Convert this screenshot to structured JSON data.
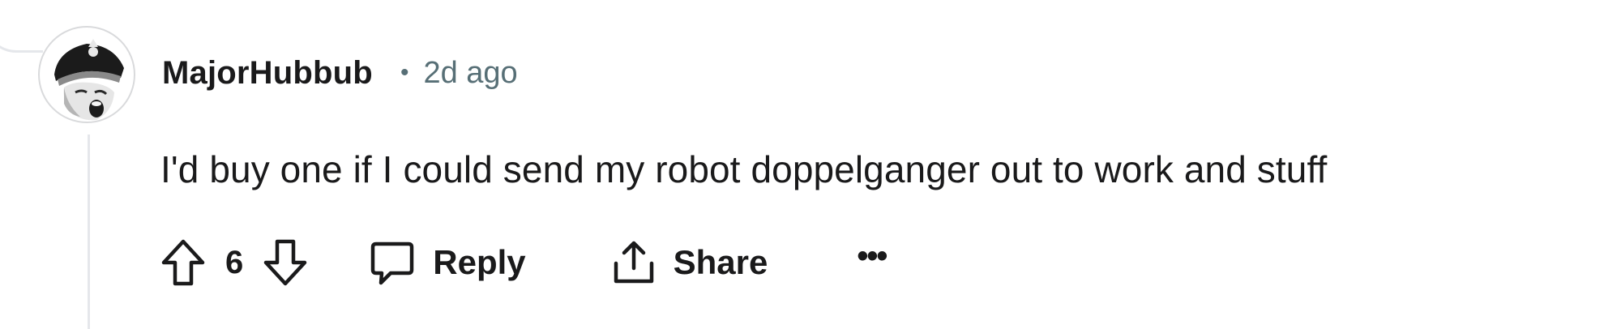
{
  "comment": {
    "author": "MajorHubbub",
    "separator": "•",
    "age": "2d ago",
    "body": "I'd buy one if I could send my robot doppelganger out to work and stuff",
    "score": "6"
  },
  "actions": {
    "reply_label": "Reply",
    "share_label": "Share",
    "more_label": "•••"
  },
  "icons": {
    "upvote": "arrow-up-outline-icon",
    "downvote": "arrow-down-outline-icon",
    "reply": "speech-bubble-icon",
    "share": "share-upload-icon",
    "more": "ellipsis-icon"
  },
  "colors": {
    "text": "#1a1a1b",
    "meta": "#576f76",
    "thread_line": "#e5e7eb"
  }
}
